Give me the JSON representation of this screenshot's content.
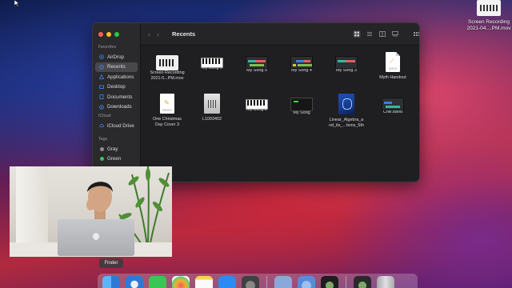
{
  "desktop": {
    "file_line1": "Screen Recording",
    "file_line2": "2021-04....PM.mov"
  },
  "finder": {
    "title": "Recents",
    "sidebar": {
      "favorites_heading": "Favorites",
      "favorites": [
        {
          "label": "AirDrop",
          "icon": "airdrop-icon"
        },
        {
          "label": "Recents",
          "icon": "clock-icon",
          "active": true
        },
        {
          "label": "Applications",
          "icon": "applications-icon"
        },
        {
          "label": "Desktop",
          "icon": "desktop-icon"
        },
        {
          "label": "Documents",
          "icon": "document-icon"
        },
        {
          "label": "Downloads",
          "icon": "download-icon"
        }
      ],
      "icloud_heading": "iCloud",
      "icloud": [
        {
          "label": "iCloud Drive",
          "icon": "cloud-icon"
        }
      ],
      "tags_heading": "Tags",
      "tags": [
        {
          "label": "Gray",
          "color": "#8e8e93"
        },
        {
          "label": "Green",
          "color": "#32c85a"
        }
      ]
    },
    "files": [
      {
        "line1": "Screen Recording",
        "line2": "2021-0...PM.mov",
        "kind": "video"
      },
      {
        "line1": "My Song 6",
        "line2": "",
        "kind": "piano"
      },
      {
        "line1": "My Song 5",
        "line2": "",
        "kind": "daw"
      },
      {
        "line1": "My Song 4",
        "line2": "",
        "kind": "daw"
      },
      {
        "line1": "My Song 3",
        "line2": "",
        "kind": "daw"
      },
      {
        "line1": "Myth Handout",
        "line2": "",
        "kind": "docx",
        "badge": "DOCX"
      },
      {
        "line1": "One Christmas",
        "line2": "Day Cover 3",
        "kind": "pages",
        "badge": "PAGES"
      },
      {
        "line1": "L1003402",
        "line2": "",
        "kind": "generic"
      },
      {
        "line1": "My Song 2",
        "line2": "",
        "kind": "piano"
      },
      {
        "line1": "My Song",
        "line2": "",
        "kind": "terminal"
      },
      {
        "line1": "Linear_Algebra_a",
        "line2": "nd_its_...tions_5th",
        "kind": "book"
      },
      {
        "line1": "Chill.band",
        "line2": "",
        "kind": "daw"
      }
    ]
  },
  "dock": {
    "tooltip": "Finder",
    "apps": [
      {
        "name": "finder",
        "color": "#3b8ee8"
      },
      {
        "name": "safari",
        "color": "#2d7ad6"
      },
      {
        "name": "messages",
        "color": "#36c754"
      },
      {
        "name": "photos",
        "color": "#f0b030"
      },
      {
        "name": "notes",
        "color": "#f6d34a"
      },
      {
        "name": "app-store",
        "color": "#2a8cf0"
      },
      {
        "name": "logic-pro",
        "color": "#404040"
      },
      {
        "name": "preview",
        "color": "#8aa8d8"
      },
      {
        "name": "quicktime",
        "color": "#5a8ad8"
      },
      {
        "name": "garageband",
        "color": "#1e1e1e"
      },
      {
        "name": "music",
        "color": "#2a2a2a"
      },
      {
        "name": "trash",
        "color": "#c0c0c4"
      }
    ]
  }
}
